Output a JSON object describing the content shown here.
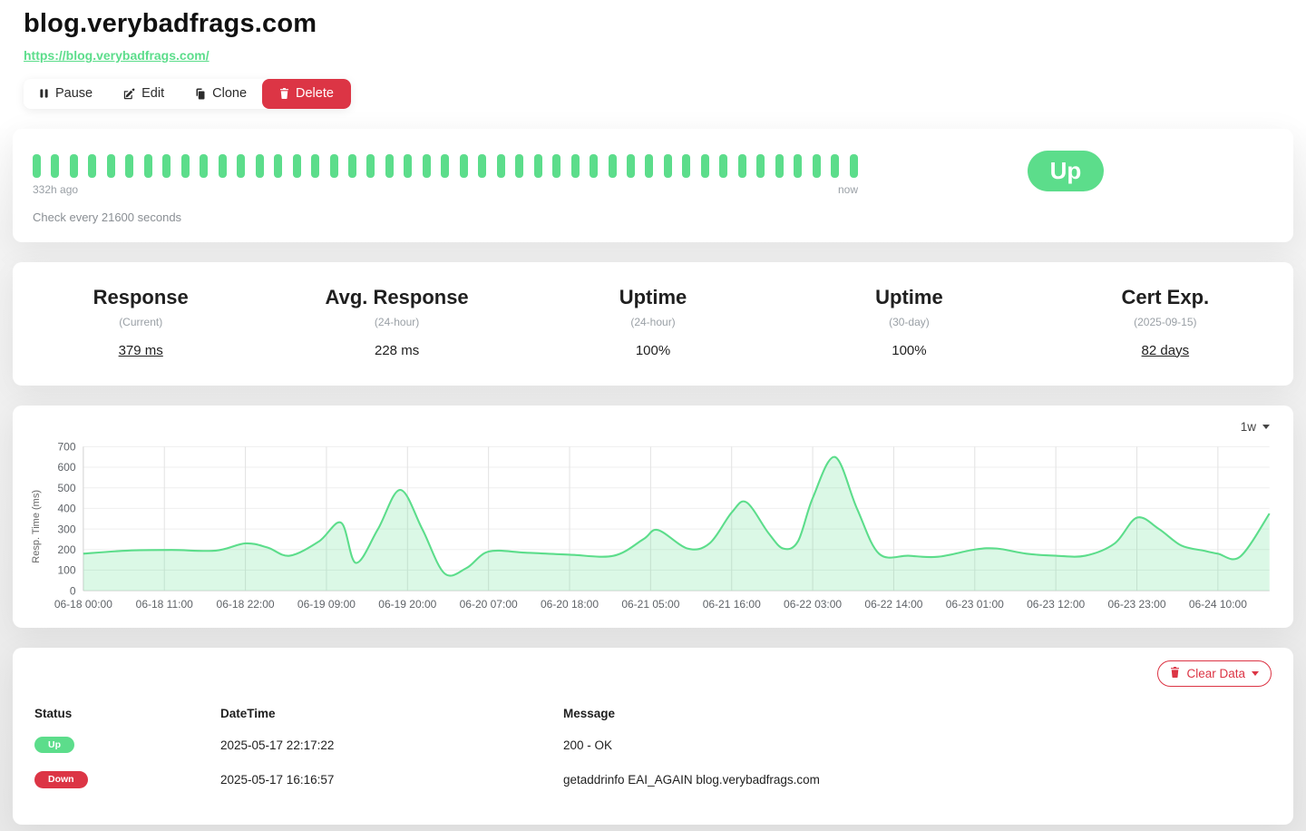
{
  "page": {
    "title": "blog.verybadfrags.com",
    "url": "https://blog.verybadfrags.com/"
  },
  "toolbar": {
    "pause_label": "Pause",
    "edit_label": "Edit",
    "clone_label": "Clone",
    "delete_label": "Delete"
  },
  "monitor": {
    "status_label": "Up",
    "beats": 45,
    "range_start": "332h ago",
    "range_end": "now",
    "check_interval": "Check every 21600 seconds"
  },
  "stats": [
    {
      "title": "Response",
      "subtitle": "(Current)",
      "value": "379 ms"
    },
    {
      "title": "Avg. Response",
      "subtitle": "(24-hour)",
      "value": "228 ms"
    },
    {
      "title": "Uptime",
      "subtitle": "(24-hour)",
      "value": "100%"
    },
    {
      "title": "Uptime",
      "subtitle": "(30-day)",
      "value": "100%"
    },
    {
      "title": "Cert Exp.",
      "subtitle": "(2025-09-15)",
      "value": "82 days"
    }
  ],
  "chart": {
    "period": "1w"
  },
  "chart_data": {
    "type": "area",
    "title": "",
    "ylabel": "Resp. Time (ms)",
    "ylim": [
      0,
      700
    ],
    "yticks": [
      0,
      100,
      200,
      300,
      400,
      500,
      600,
      700
    ],
    "xmax_hours": 161,
    "xtick_hours": [
      0,
      11,
      22,
      33,
      44,
      55,
      66,
      77,
      88,
      99,
      110,
      121,
      132,
      143,
      154
    ],
    "xtick_labels": [
      "06-18 00:00",
      "06-18 11:00",
      "06-18 22:00",
      "06-19 09:00",
      "06-19 20:00",
      "06-20 07:00",
      "06-20 18:00",
      "06-21 05:00",
      "06-21 16:00",
      "06-22 03:00",
      "06-22 14:00",
      "06-23 01:00",
      "06-23 12:00",
      "06-23 23:00",
      "06-24 10:00"
    ],
    "grid": true,
    "legend": "none",
    "line_color": "#5cdd8b",
    "fill_color": "rgba(92,221,139,0.22)",
    "series": [
      {
        "name": "Resp. Time (ms)",
        "points": [
          [
            0,
            180
          ],
          [
            6,
            195
          ],
          [
            12,
            198
          ],
          [
            18,
            195
          ],
          [
            22,
            230
          ],
          [
            25,
            210
          ],
          [
            28,
            170
          ],
          [
            32,
            240
          ],
          [
            35,
            330
          ],
          [
            37,
            135
          ],
          [
            40,
            300
          ],
          [
            43,
            490
          ],
          [
            46,
            300
          ],
          [
            49,
            85
          ],
          [
            52,
            110
          ],
          [
            55,
            190
          ],
          [
            60,
            185
          ],
          [
            66,
            175
          ],
          [
            72,
            170
          ],
          [
            76,
            250
          ],
          [
            78,
            295
          ],
          [
            82,
            205
          ],
          [
            85,
            230
          ],
          [
            88,
            380
          ],
          [
            90,
            430
          ],
          [
            93,
            280
          ],
          [
            95,
            205
          ],
          [
            97,
            240
          ],
          [
            99,
            450
          ],
          [
            102,
            650
          ],
          [
            105,
            400
          ],
          [
            108,
            180
          ],
          [
            112,
            170
          ],
          [
            116,
            165
          ],
          [
            121,
            200
          ],
          [
            124,
            205
          ],
          [
            128,
            180
          ],
          [
            132,
            170
          ],
          [
            136,
            170
          ],
          [
            140,
            230
          ],
          [
            143,
            355
          ],
          [
            146,
            300
          ],
          [
            149,
            220
          ],
          [
            152,
            195
          ],
          [
            154,
            180
          ],
          [
            157,
            165
          ],
          [
            161,
            375
          ]
        ]
      }
    ]
  },
  "events": {
    "clear_label": "Clear Data",
    "columns": [
      "Status",
      "DateTime",
      "Message"
    ],
    "rows": [
      {
        "status": "Up",
        "datetime": "2025-05-17 22:17:22",
        "message": "200 - OK"
      },
      {
        "status": "Down",
        "datetime": "2025-05-17 16:16:57",
        "message": "getaddrinfo EAI_AGAIN blog.verybadfrags.com"
      }
    ]
  },
  "colors": {
    "green": "#5cdd8b",
    "red": "#dc3545"
  }
}
